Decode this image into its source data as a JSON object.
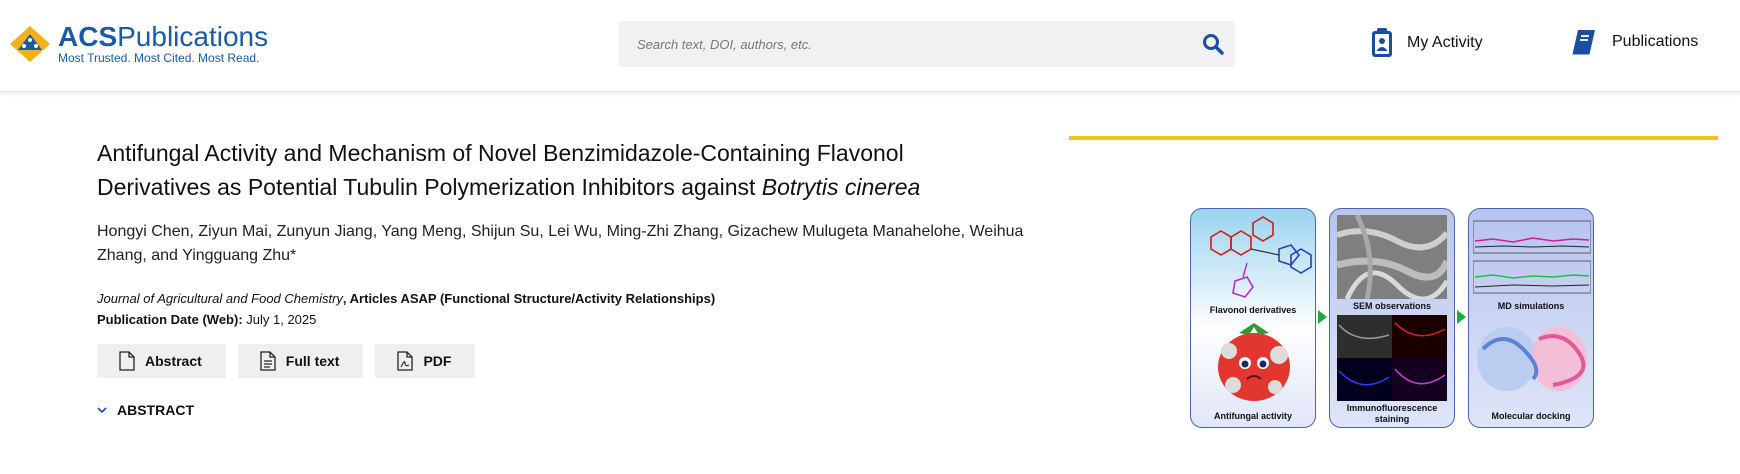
{
  "header": {
    "logo": {
      "brand_bold": "ACS",
      "brand_rest": "Publications",
      "tagline": "Most Trusted. Most Cited. Most Read."
    },
    "search": {
      "placeholder": "Search text, DOI, authors, etc."
    },
    "nav": {
      "activity_label": "My Activity",
      "publications_label": "Publications"
    }
  },
  "article": {
    "title_line1": "Antifungal Activity and Mechanism of Novel Benzimidazole-Containing Flavonol",
    "title_line2_prefix": "Derivatives as Potential Tubulin Polymerization Inhibitors against ",
    "title_species": "Botrytis cinerea",
    "authors": "Hongyi Chen, Ziyun Mai, Zunyun Jiang, Yang Meng, Shijun Su, Lei Wu, Ming-Zhi Zhang, Gizachew Mulugeta Manahelohe, Weihua Zhang, and Yingguang Zhu*",
    "journal": "Journal of Agricultural and Food Chemistry",
    "journal_suffix": ", Articles ASAP (Functional Structure/Activity Relationships)",
    "pubdate_label": "Publication Date (Web):",
    "pubdate_value": " July 1, 2025"
  },
  "buttons": {
    "abstract": "Abstract",
    "fulltext": "Full text",
    "pdf": "PDF"
  },
  "abstract_toggle": "ABSTRACT",
  "toc_graphic": {
    "captions": {
      "flavonol": "Flavonol derivatives",
      "antifungal": "Antifungal activity",
      "sem": "SEM observations",
      "immuno": "Immunofluorescence staining",
      "md": "MD simulations",
      "docking": "Molecular docking"
    }
  },
  "colors": {
    "brand_blue": "#1a5aa7",
    "accent_yellow": "#f2c31e",
    "arrow_green": "#1faa3c"
  }
}
